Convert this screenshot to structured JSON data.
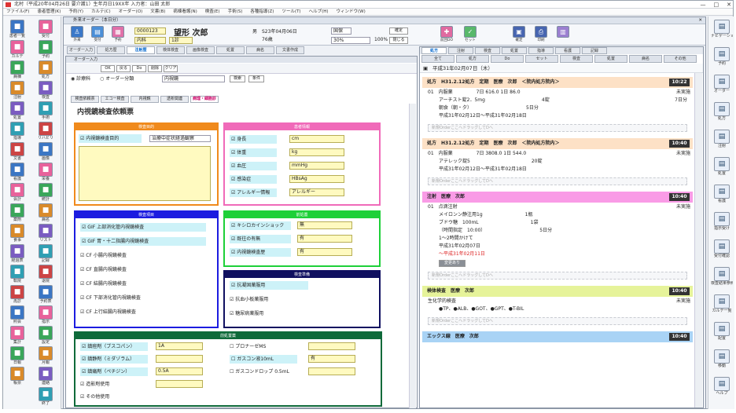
{
  "window": {
    "title": "北村（平成20年04月26日 要介護1）生年月日19XX年 入力者：山田 太郎",
    "minimize": "—",
    "maximize": "□",
    "close": "✕"
  },
  "menu": [
    "ファイル(F)",
    "患者管理(K)",
    "予約(Y)",
    "カルテ(C)",
    "オーダー(O)",
    "文書(B)",
    "病棟看護(N)",
    "検査(E)",
    "手術(S)",
    "各種指導(Z)",
    "ツール(T)",
    "ヘルプ(H)",
    "ウィンドウ(W)"
  ],
  "left_sidebar": [
    [
      "患者一覧",
      "受付"
    ],
    [
      "カルテ",
      "予約"
    ],
    [
      "病棟",
      "処方"
    ],
    [
      "注射",
      "検査"
    ],
    [
      "処置",
      "手術"
    ],
    [
      "指導",
      "リハビリ"
    ],
    [
      "文書",
      "画像"
    ],
    [
      "看護",
      "栄養"
    ],
    [
      "会計",
      "統計"
    ],
    [
      "薬剤",
      "病名"
    ],
    [
      "食事",
      "リスト"
    ],
    [
      "経過表",
      "記録"
    ],
    [
      "転院",
      "退院"
    ],
    [
      "再診",
      "予約表"
    ],
    [
      "照会",
      "指示"
    ],
    [
      "集計",
      "設定"
    ],
    [
      "日報",
      "月報"
    ],
    [
      "帳票",
      "連絡"
    ],
    [
      "",
      "終了"
    ]
  ],
  "right_sidebar": [
    "ナビゲーション",
    "予約",
    "オーダー",
    "処方",
    "注射",
    "処置",
    "看護",
    "指示受け",
    "受付確認",
    "検査結果参照",
    "カルテ一覧",
    "配置",
    "移動",
    "ヘルプ"
  ],
  "main_window": {
    "title": "外来オーダー（本日分）",
    "close": "✕"
  },
  "toolbar": {
    "buttons": [
      "外来",
      "受付",
      "予約",
      "記録"
    ],
    "patient_id": "0000123",
    "patient_name": "望形 次郎",
    "age": "76歳",
    "gender": "男",
    "birth": "S23年04月06日",
    "insurance": "国保",
    "right_buttons": [
      "処方",
      "注射",
      "検査",
      "処置"
    ],
    "right_labels": [
      "前回DO",
      "セット",
      "確定",
      "印刷"
    ],
    "dept_field": "内科",
    "room_field": "1診",
    "ratio_field": "30%",
    "ratio2_field": "100%",
    "ok_button": "確定",
    "close_button": "閉じる"
  },
  "main_tabs": [
    "オーダー入力",
    "処方歴",
    "注射歴",
    "検体検査",
    "画像検査",
    "処置",
    "病名",
    "文書作成"
  ],
  "form": {
    "window_title": "オーダー入力",
    "toolbar_buttons": [
      "OK",
      "戻る",
      "Do",
      "削除",
      "クリア"
    ],
    "radio_1": "診療科",
    "radio_2": "オーダー分類",
    "select_value": "内視鏡",
    "search_btn": "検索",
    "clear_btn": "条件",
    "subtabs": [
      "検査依頼票",
      "エコー検査",
      "内視鏡",
      "透析関連",
      "病理・細胞診"
    ],
    "title": "内視鏡検査依頼票",
    "sections": {
      "s1": {
        "title": "検査目的",
        "label": "内視鏡検査目的",
        "select": "治療中症状経過観察"
      },
      "s2": {
        "title": "患者情報",
        "rows": [
          [
            "身長",
            "cm"
          ],
          [
            "体重",
            "kg"
          ],
          [
            "血圧",
            "mmHg"
          ],
          [
            "感染症",
            "HBsAg"
          ],
          [
            "アレルギー情報",
            "アレルギー"
          ]
        ]
      },
      "s3": {
        "title": "検査項目",
        "rows": [
          "GIF 上部消化管内視鏡検査",
          "GIF 胃・十二指腸内視鏡検査",
          "CF 小腸内視鏡検査",
          "CF 直腸内視鏡検査",
          "CF 結腸内視鏡検査",
          "CF 下部消化管内視鏡検査",
          "CF 上行結腸内視鏡検査"
        ]
      },
      "s4": {
        "title": "前処置",
        "rows": [
          [
            "キシロカインショック",
            "無"
          ],
          [
            "既往の有無",
            "有"
          ],
          [
            "内視鏡検査歴",
            "有"
          ]
        ]
      },
      "s5": {
        "title": "検査準備",
        "rows": [
          "抗凝固薬服用",
          "抗血小板薬服用",
          "糖尿病薬服用"
        ]
      },
      "s6": {
        "title": "前処置薬",
        "left": [
          "鎮痙剤（ブスコパン）",
          "鎮静剤（ミダゾラム）",
          "鎮痛剤（ペチジン）",
          "造影剤使用",
          "その他使用"
        ],
        "left_vals": [
          "1A",
          "",
          "0.5A",
          "",
          ""
        ],
        "right": [
          "プロナーゼMS",
          "ガスコン液10mL",
          "ガスコンドロップ 0.5mL"
        ],
        "right_vals": [
          "",
          "有",
          ""
        ]
      }
    }
  },
  "right_panel": {
    "tabs": [
      "処方",
      "注射",
      "検査",
      "処置",
      "指導",
      "看護",
      "記録"
    ],
    "sub_tabs": [
      "全て",
      "処方",
      "Do",
      "セット",
      "検査",
      "処置",
      "病名",
      "その他"
    ],
    "date": "平成31年02月07日（木）",
    "drop_text": "新規OrderここへドラッグしてDへ",
    "orders": [
      {
        "head": "処方　H31.2.12処方　定期　医療　次郎　＜院内処方院内＞",
        "time": "10:22",
        "lines": [
          "01　内服薬　　　　　7日 616.0 1日 86.0",
          "アーチスト錠2．5mg　　　　　　　　　　　　4錠",
          "朝食（朝・夕）　　　　　　　　　　　　5日分",
          "平成31年02月12日〜平成31年02月18日"
        ],
        "status": "未実施",
        "days": "7日分"
      },
      {
        "head": "処方　H31.2.12処方　定期　医療　次郎　＜院内処方院内＞",
        "time": "10:40",
        "lines": [
          "01　内服薬　　　　　7日 3808.0 1日 544.0",
          "アテレック錠5　　　　　　　　　　　　　20錠",
          "平成31年02月12日〜平成31年02月18日"
        ],
        "status": "未実施"
      },
      {
        "head": "注射　医療　次郎",
        "time": "10:40",
        "lines": [
          "01　点滴注射",
          "メイロンン静注用1g　　　　　　　　　1瓶",
          "ブドウ糖　100mL　　　　　　　　　　　1袋",
          "（時間指定　10:00）　　　　　　　　　　　　5日分",
          "1〜2時間かけて",
          "平成31年02月07日",
          "〜平成31年02月11日"
        ],
        "status": "未実施",
        "tag": "変更あり"
      },
      {
        "head": "検体検査　医療　次郎",
        "time": "10:40",
        "lines": [
          "生化学的検査",
          "●TP、●ALB、●GOT、●GPT、●T-BIL"
        ],
        "status": "未実施"
      },
      {
        "head": "エックス線　医療　次郎",
        "time": "10:40",
        "lines": []
      }
    ]
  }
}
